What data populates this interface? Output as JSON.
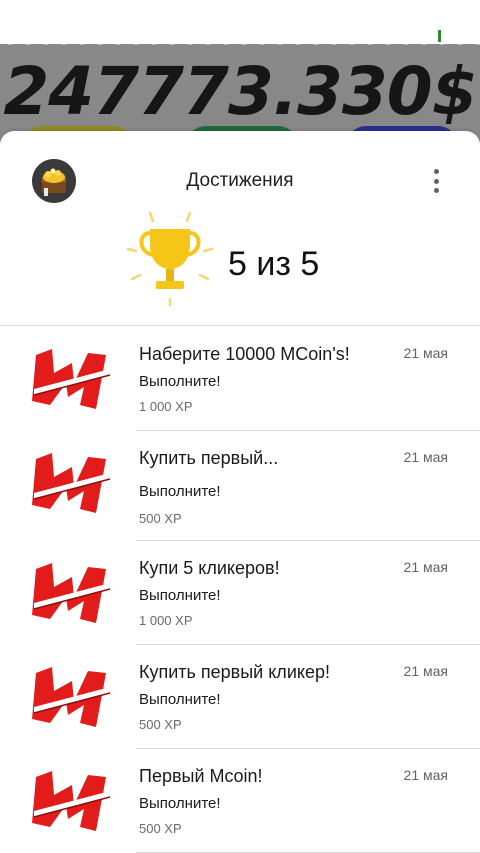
{
  "game": {
    "balance": "247773.330$"
  },
  "sheet": {
    "title": "Достижения",
    "summary": "5 из 5"
  },
  "achievements": [
    {
      "title": "Наберите 10000 MCoin's!",
      "status": "Выполните!",
      "xp": "1 000 XP",
      "date": "21 мая"
    },
    {
      "title": "Купить первый...",
      "status": "Выполните!",
      "xp": "500 XP",
      "date": "21 мая"
    },
    {
      "title": "Купи 5 кликеров!",
      "status": "Выполните!",
      "xp": "1 000 XP",
      "date": "21 мая"
    },
    {
      "title": "Купить первый кликер!",
      "status": "Выполните!",
      "xp": "500 XP",
      "date": "21 мая"
    },
    {
      "title": "Первый Mcoin!",
      "status": "Выполните!",
      "xp": "500 XP",
      "date": "21 мая"
    }
  ],
  "colors": {
    "icon_red": "#e21b1b",
    "trophy_gold": "#f5c518",
    "divider": "#d9d9d9"
  }
}
